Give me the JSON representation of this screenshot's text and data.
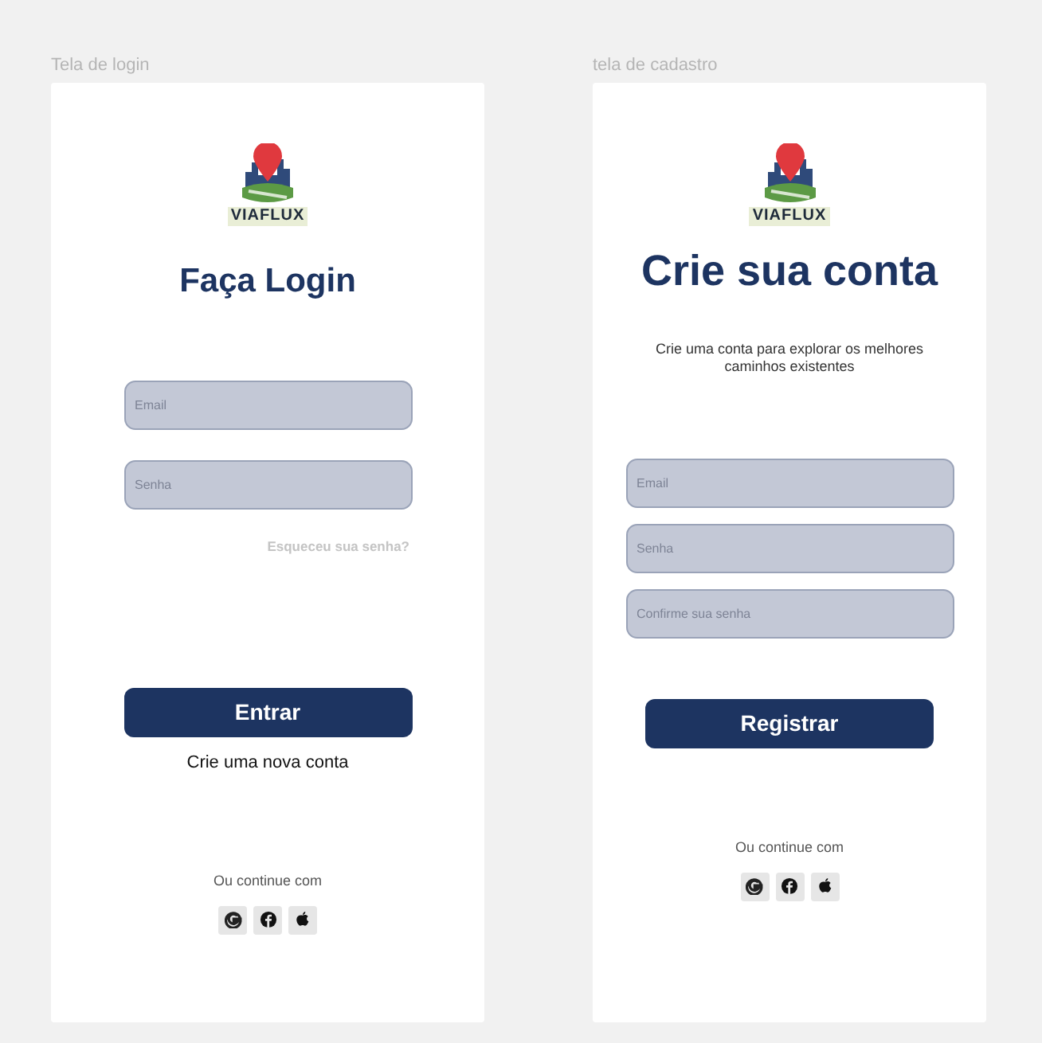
{
  "screens": [
    {
      "kind": "login",
      "frame_label": "Tela de  login",
      "brand": "VIAFLUX",
      "title": "Faça Login",
      "fields": [
        {
          "placeholder": "Email"
        },
        {
          "placeholder": "Senha"
        }
      ],
      "forgot_link": "Esqueceu sua senha?",
      "button": "Entrar",
      "secondary_link": "Crie uma nova conta",
      "social_label": "Ou continue com",
      "social": [
        {
          "kind": "google"
        },
        {
          "kind": "facebook"
        },
        {
          "kind": "apple"
        }
      ]
    },
    {
      "kind": "signup",
      "frame_label": "tela de cadastro",
      "brand": "VIAFLUX",
      "title": "Crie sua conta",
      "subtitle": "Crie uma conta para explorar os melhores caminhos existentes",
      "fields": [
        {
          "placeholder": "Email"
        },
        {
          "placeholder": "Senha"
        },
        {
          "placeholder": "Confirme sua senha"
        }
      ],
      "button": "Registrar",
      "social_label": "Ou continue com",
      "social": [
        {
          "kind": "google"
        },
        {
          "kind": "facebook"
        },
        {
          "kind": "apple"
        }
      ]
    }
  ]
}
